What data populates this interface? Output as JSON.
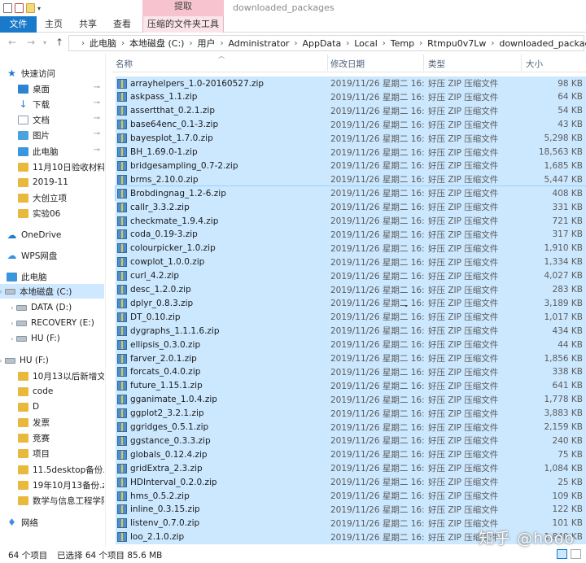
{
  "window": {
    "title": "downloaded_packages",
    "context_header": "提取"
  },
  "ribbon": {
    "tabs": [
      "文件",
      "主页",
      "共享",
      "查看",
      "压缩的文件夹工具"
    ]
  },
  "address": {
    "crumbs": [
      "此电脑",
      "本地磁盘 (C:)",
      "用户",
      "Administrator",
      "AppData",
      "Local",
      "Temp",
      "Rtmpu0v7Lw",
      "downloaded_packages"
    ]
  },
  "nav": {
    "items": [
      {
        "label": "快速访问",
        "icon": "star-icon",
        "kind": "star",
        "pinned": false,
        "chev": false
      },
      {
        "label": "桌面",
        "icon": "desktop-icon",
        "kind": "desk",
        "pinned": true,
        "chev": false
      },
      {
        "label": "下载",
        "icon": "download-icon",
        "kind": "down",
        "pinned": true,
        "chev": false
      },
      {
        "label": "文档",
        "icon": "document-icon",
        "kind": "doc",
        "pinned": true,
        "chev": false
      },
      {
        "label": "图片",
        "icon": "picture-icon",
        "kind": "pic",
        "pinned": true,
        "chev": false
      },
      {
        "label": "此电脑",
        "icon": "pc-icon",
        "kind": "pc",
        "pinned": true,
        "chev": false
      },
      {
        "label": "11月10日验收材料",
        "icon": "folder-icon",
        "kind": "folder",
        "pinned": true,
        "chev": false
      },
      {
        "label": "2019-11",
        "icon": "folder-icon",
        "kind": "folder",
        "pinned": false,
        "chev": false
      },
      {
        "label": "大创立项",
        "icon": "folder-icon",
        "kind": "folder",
        "pinned": false,
        "chev": false
      },
      {
        "label": "实验06",
        "icon": "folder-icon",
        "kind": "folder",
        "pinned": false,
        "chev": false
      },
      {
        "label": "OneDrive",
        "icon": "cloud-icon",
        "kind": "cloud",
        "pinned": false,
        "chev": false
      },
      {
        "label": "WPS网盘",
        "icon": "wps-cloud-icon",
        "kind": "wps",
        "pinned": false,
        "chev": false
      },
      {
        "label": "此电脑",
        "icon": "pc-icon",
        "kind": "pc",
        "pinned": false,
        "chev": false
      },
      {
        "label": "本地磁盘 (C:)",
        "icon": "drive-icon",
        "kind": "drive",
        "pinned": false,
        "chev": true,
        "selected": true
      },
      {
        "label": "DATA (D:)",
        "icon": "drive-icon",
        "kind": "drive",
        "pinned": false,
        "chev": true
      },
      {
        "label": "RECOVERY (E:)",
        "icon": "drive-icon",
        "kind": "drive",
        "pinned": false,
        "chev": true
      },
      {
        "label": "HU (F:)",
        "icon": "drive-icon",
        "kind": "drive",
        "pinned": false,
        "chev": true
      },
      {
        "label": "HU (F:)",
        "icon": "drive-icon",
        "kind": "drive",
        "pinned": false,
        "chev": true
      },
      {
        "label": "10月13以后新增文件",
        "icon": "folder-icon",
        "kind": "folder",
        "pinned": false,
        "chev": false
      },
      {
        "label": "code",
        "icon": "folder-icon",
        "kind": "folder",
        "pinned": false,
        "chev": false
      },
      {
        "label": "D",
        "icon": "folder-icon",
        "kind": "folder",
        "pinned": false,
        "chev": false
      },
      {
        "label": "发票",
        "icon": "folder-icon",
        "kind": "folder",
        "pinned": false,
        "chev": false
      },
      {
        "label": "竞赛",
        "icon": "folder-icon",
        "kind": "folder",
        "pinned": false,
        "chev": false
      },
      {
        "label": "项目",
        "icon": "folder-icon",
        "kind": "folder",
        "pinned": false,
        "chev": false
      },
      {
        "label": "11.5desktop备份.z",
        "icon": "zip-icon",
        "kind": "folder",
        "pinned": false,
        "chev": false
      },
      {
        "label": "19年10月13备份.zi",
        "icon": "zip-icon",
        "kind": "folder",
        "pinned": false,
        "chev": false
      },
      {
        "label": "数学与信息工程学院",
        "icon": "folder-icon",
        "kind": "folder",
        "pinned": false,
        "chev": false
      },
      {
        "label": "网络",
        "icon": "network-icon",
        "kind": "net",
        "pinned": false,
        "chev": false
      }
    ]
  },
  "columns": {
    "name": "名称",
    "date": "修改日期",
    "type": "类型",
    "size": "大小"
  },
  "files": [
    {
      "name": "arrayhelpers_1.0-20160527.zip",
      "date": "2019/11/26 星期二 16:...",
      "type": "好压 ZIP 压缩文件",
      "size": "98 KB"
    },
    {
      "name": "askpass_1.1.zip",
      "date": "2019/11/26 星期二 16:...",
      "type": "好压 ZIP 压缩文件",
      "size": "64 KB"
    },
    {
      "name": "assertthat_0.2.1.zip",
      "date": "2019/11/26 星期二 16:...",
      "type": "好压 ZIP 压缩文件",
      "size": "54 KB"
    },
    {
      "name": "base64enc_0.1-3.zip",
      "date": "2019/11/26 星期二 16:...",
      "type": "好压 ZIP 压缩文件",
      "size": "43 KB"
    },
    {
      "name": "bayesplot_1.7.0.zip",
      "date": "2019/11/26 星期二 16:...",
      "type": "好压 ZIP 压缩文件",
      "size": "5,298 KB"
    },
    {
      "name": "BH_1.69.0-1.zip",
      "date": "2019/11/26 星期二 16:...",
      "type": "好压 ZIP 压缩文件",
      "size": "18,563 KB"
    },
    {
      "name": "bridgesampling_0.7-2.zip",
      "date": "2019/11/26 星期二 16:...",
      "type": "好压 ZIP 压缩文件",
      "size": "1,685 KB"
    },
    {
      "name": "brms_2.10.0.zip",
      "date": "2019/11/26 星期二 16:...",
      "type": "好压 ZIP 压缩文件",
      "size": "5,447 KB"
    },
    {
      "name": "Brobdingnag_1.2-6.zip",
      "date": "2019/11/26 星期二 16:...",
      "type": "好压 ZIP 压缩文件",
      "size": "408 KB"
    },
    {
      "name": "callr_3.3.2.zip",
      "date": "2019/11/26 星期二 16:...",
      "type": "好压 ZIP 压缩文件",
      "size": "331 KB"
    },
    {
      "name": "checkmate_1.9.4.zip",
      "date": "2019/11/26 星期二 16:...",
      "type": "好压 ZIP 压缩文件",
      "size": "721 KB"
    },
    {
      "name": "coda_0.19-3.zip",
      "date": "2019/11/26 星期二 16:...",
      "type": "好压 ZIP 压缩文件",
      "size": "317 KB"
    },
    {
      "name": "colourpicker_1.0.zip",
      "date": "2019/11/26 星期二 16:...",
      "type": "好压 ZIP 压缩文件",
      "size": "1,910 KB"
    },
    {
      "name": "cowplot_1.0.0.zip",
      "date": "2019/11/26 星期二 16:...",
      "type": "好压 ZIP 压缩文件",
      "size": "1,334 KB"
    },
    {
      "name": "curl_4.2.zip",
      "date": "2019/11/26 星期二 16:...",
      "type": "好压 ZIP 压缩文件",
      "size": "4,027 KB"
    },
    {
      "name": "desc_1.2.0.zip",
      "date": "2019/11/26 星期二 16:...",
      "type": "好压 ZIP 压缩文件",
      "size": "283 KB"
    },
    {
      "name": "dplyr_0.8.3.zip",
      "date": "2019/11/26 星期二 16:...",
      "type": "好压 ZIP 压缩文件",
      "size": "3,189 KB"
    },
    {
      "name": "DT_0.10.zip",
      "date": "2019/11/26 星期二 16:...",
      "type": "好压 ZIP 压缩文件",
      "size": "1,017 KB"
    },
    {
      "name": "dygraphs_1.1.1.6.zip",
      "date": "2019/11/26 星期二 16:...",
      "type": "好压 ZIP 压缩文件",
      "size": "434 KB"
    },
    {
      "name": "ellipsis_0.3.0.zip",
      "date": "2019/11/26 星期二 16:...",
      "type": "好压 ZIP 压缩文件",
      "size": "44 KB"
    },
    {
      "name": "farver_2.0.1.zip",
      "date": "2019/11/26 星期二 16:...",
      "type": "好压 ZIP 压缩文件",
      "size": "1,856 KB"
    },
    {
      "name": "forcats_0.4.0.zip",
      "date": "2019/11/26 星期二 16:...",
      "type": "好压 ZIP 压缩文件",
      "size": "338 KB"
    },
    {
      "name": "future_1.15.1.zip",
      "date": "2019/11/26 星期二 16:...",
      "type": "好压 ZIP 压缩文件",
      "size": "641 KB"
    },
    {
      "name": "gganimate_1.0.4.zip",
      "date": "2019/11/26 星期二 16:...",
      "type": "好压 ZIP 压缩文件",
      "size": "1,778 KB"
    },
    {
      "name": "ggplot2_3.2.1.zip",
      "date": "2019/11/26 星期二 16:...",
      "type": "好压 ZIP 压缩文件",
      "size": "3,883 KB"
    },
    {
      "name": "ggridges_0.5.1.zip",
      "date": "2019/11/26 星期二 16:...",
      "type": "好压 ZIP 压缩文件",
      "size": "2,159 KB"
    },
    {
      "name": "ggstance_0.3.3.zip",
      "date": "2019/11/26 星期二 16:...",
      "type": "好压 ZIP 压缩文件",
      "size": "240 KB"
    },
    {
      "name": "globals_0.12.4.zip",
      "date": "2019/11/26 星期二 16:...",
      "type": "好压 ZIP 压缩文件",
      "size": "75 KB"
    },
    {
      "name": "gridExtra_2.3.zip",
      "date": "2019/11/26 星期二 16:...",
      "type": "好压 ZIP 压缩文件",
      "size": "1,084 KB"
    },
    {
      "name": "HDInterval_0.2.0.zip",
      "date": "2019/11/26 星期二 16:...",
      "type": "好压 ZIP 压缩文件",
      "size": "25 KB"
    },
    {
      "name": "hms_0.5.2.zip",
      "date": "2019/11/26 星期二 16:...",
      "type": "好压 ZIP 压缩文件",
      "size": "109 KB"
    },
    {
      "name": "inline_0.3.15.zip",
      "date": "2019/11/26 星期二 16:...",
      "type": "好压 ZIP 压缩文件",
      "size": "122 KB"
    },
    {
      "name": "listenv_0.7.0.zip",
      "date": "2019/11/26 星期二 16:...",
      "type": "好压 ZIP 压缩文件",
      "size": "101 KB"
    },
    {
      "name": "loo_2.1.0.zip",
      "date": "2019/11/26 星期二 16:...",
      "type": "好压 ZIP 压缩文件",
      "size": "1,840 KB"
    }
  ],
  "status": {
    "count": "64 个项目",
    "selected": "已选择 64 个项目  85.6 MB"
  },
  "watermark": "知乎 @hooo"
}
